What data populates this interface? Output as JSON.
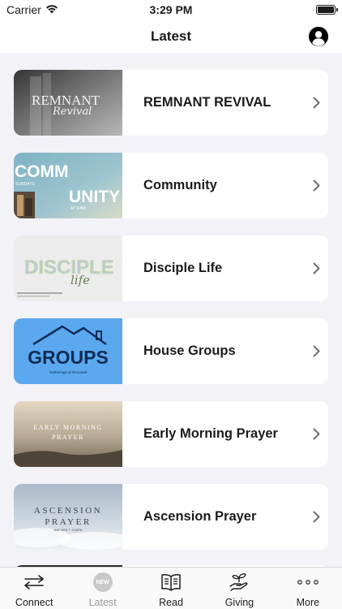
{
  "status": {
    "carrier": "Carrier",
    "time": "3:29 PM"
  },
  "header": {
    "title": "Latest"
  },
  "cards": [
    {
      "title": "REMNANT REVIVAL",
      "thumb_text": [
        "REMNANT",
        "Revival"
      ]
    },
    {
      "title": "Community",
      "thumb_text": [
        "COMM",
        "UNITY",
        "SUNDAYS",
        "AT 9 AM"
      ]
    },
    {
      "title": "Disciple Life",
      "thumb_text": [
        "DISCIPLE",
        "life"
      ]
    },
    {
      "title": "House Groups",
      "thumb_text": [
        "GROUPS",
        "Gatherings at Remnant"
      ]
    },
    {
      "title": "Early Morning Prayer",
      "thumb_text": [
        "EARLY MORNING",
        "PRAYER"
      ]
    },
    {
      "title": "Ascension Prayer",
      "thumb_text": [
        "ASCENSION",
        "PRAYER",
        "MAY 29TH 7 - 8:30PM"
      ]
    }
  ],
  "tabs": [
    {
      "label": "Connect",
      "icon": "arrows-exchange-icon"
    },
    {
      "label": "Latest",
      "icon": "new-badge-icon",
      "badge": "NEW"
    },
    {
      "label": "Read",
      "icon": "book-icon"
    },
    {
      "label": "Giving",
      "icon": "hand-plant-icon"
    },
    {
      "label": "More",
      "icon": "ellipsis-icon"
    }
  ],
  "colors": {
    "accent": "#000000",
    "background": "#f2f2f7",
    "inactive_tab": "#9a9a9a",
    "house_groups": "#5ba8ef"
  }
}
